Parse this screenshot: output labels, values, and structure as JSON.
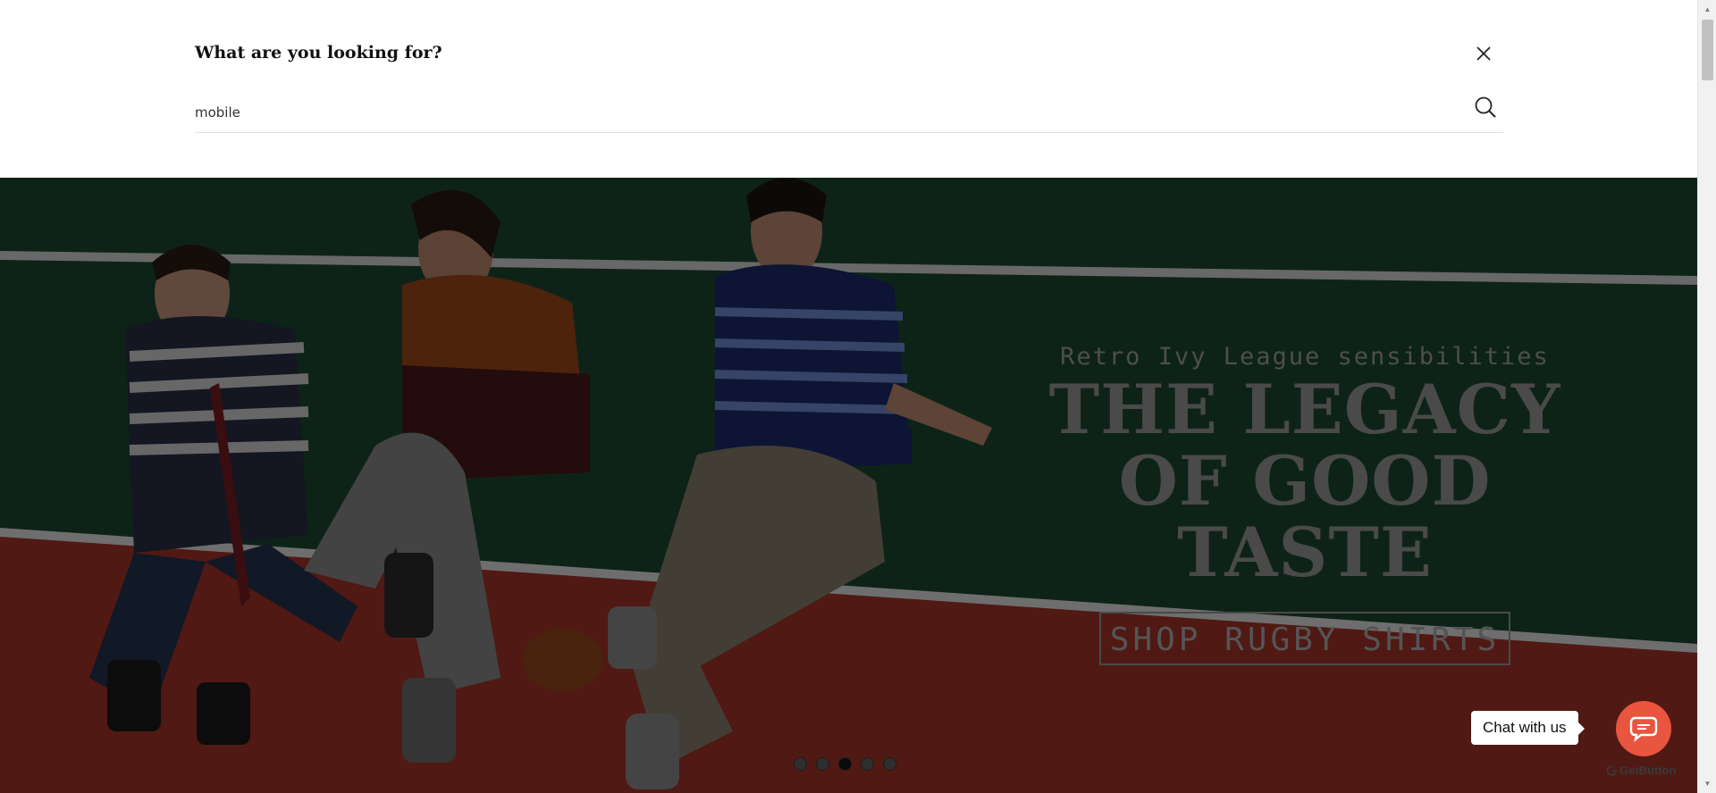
{
  "search": {
    "heading": "What are you looking for?",
    "value": "mobile",
    "close_icon": "close-icon",
    "search_icon": "search-icon"
  },
  "hero": {
    "tagline": "Retro Ivy League sensibilities",
    "title_line1": "THE LEGACY",
    "title_line2": "OF GOOD TASTE",
    "cta_label": "SHOP RUGBY SHIRTS",
    "slide_count": 5,
    "active_slide": 3,
    "colors": {
      "wall": "#1e4a33",
      "court": "#a8362a",
      "line": "#e8e8e8"
    }
  },
  "chat": {
    "label": "Chat with us",
    "brand": "GetButton",
    "accent": "#e9553f"
  }
}
